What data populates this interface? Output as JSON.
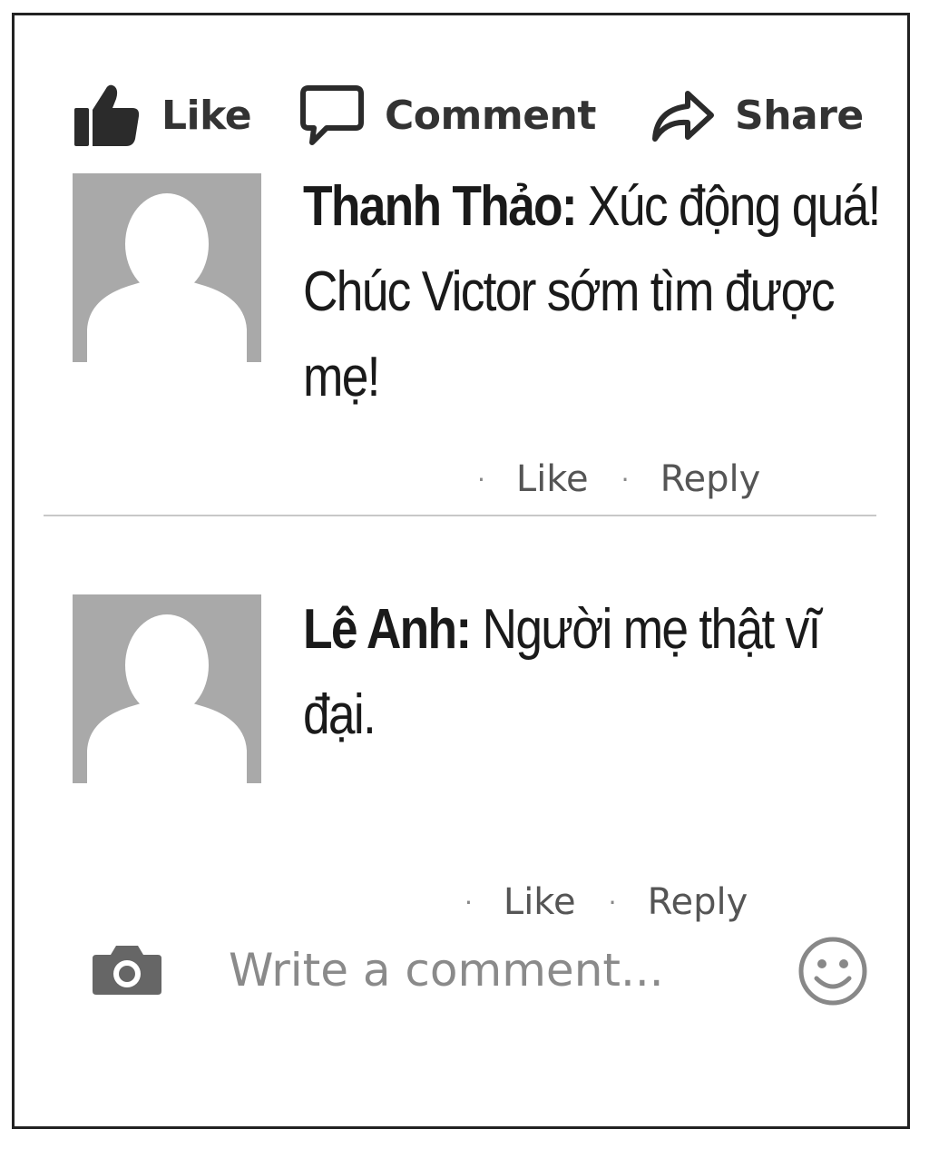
{
  "actions": {
    "like": {
      "label": "Like",
      "icon": "thumbs-up-icon"
    },
    "comment": {
      "label": "Comment",
      "icon": "speech-bubble-icon"
    },
    "share": {
      "label": "Share",
      "icon": "share-arrow-icon"
    }
  },
  "comments": [
    {
      "author": "Thanh Thảo:",
      "text": "Xúc động quá! Chúc Victor sớm tìm được mẹ!",
      "like_label": "Like",
      "reply_label": "Reply"
    },
    {
      "author": "Lê Anh:",
      "text": "Người mẹ thật vĩ đại.",
      "like_label": "Like",
      "reply_label": "Reply"
    }
  ],
  "composer": {
    "placeholder": "Write a comment...",
    "camera_icon": "camera-icon",
    "emoji_icon": "smiley-icon"
  },
  "colors": {
    "avatar_bg": "#a9a9a9",
    "text": "#1a1a1a",
    "muted": "#555555"
  }
}
